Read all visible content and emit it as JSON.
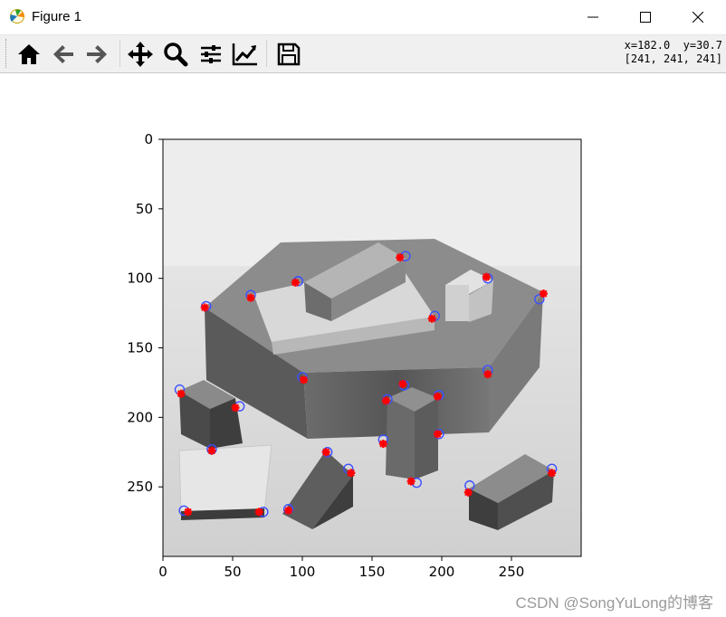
{
  "window": {
    "title": "Figure 1"
  },
  "toolbar": {
    "buttons": [
      "home-icon",
      "back-arrow-icon",
      "forward-arrow-icon",
      "pan-move-icon",
      "zoom-magnifier-icon",
      "configure-subplots-icon",
      "edit-axis-icon",
      "save-disk-icon"
    ],
    "coord_line1": "x=182.0  y=30.7",
    "coord_line2": "[241, 241, 241]"
  },
  "chart_data": {
    "type": "scatter",
    "xlim": [
      0,
      300
    ],
    "ylim": [
      300,
      0
    ],
    "xticks": [
      0,
      50,
      100,
      150,
      200,
      250
    ],
    "yticks": [
      0,
      50,
      100,
      150,
      200,
      250
    ],
    "xtick_labels": [
      "0",
      "50",
      "100",
      "150",
      "200",
      "250"
    ],
    "ytick_labels": [
      "0",
      "50",
      "100",
      "150",
      "200",
      "250"
    ],
    "title": "",
    "xlabel": "",
    "ylabel": "",
    "grid": false,
    "y_inverted": true,
    "series": [
      {
        "marker": "o",
        "color": "#3c50ff",
        "points": [
          [
            31,
            120
          ],
          [
            63,
            112
          ],
          [
            97,
            102
          ],
          [
            174,
            84
          ],
          [
            195,
            127
          ],
          [
            233,
            100
          ],
          [
            270,
            115
          ],
          [
            100,
            171
          ],
          [
            173,
            177
          ],
          [
            161,
            187
          ],
          [
            198,
            184
          ],
          [
            233,
            166
          ],
          [
            12,
            180
          ],
          [
            55,
            192
          ],
          [
            35,
            223
          ],
          [
            118,
            225
          ],
          [
            158,
            216
          ],
          [
            198,
            212
          ],
          [
            133,
            237
          ],
          [
            182,
            247
          ],
          [
            220,
            249
          ],
          [
            279,
            237
          ],
          [
            15,
            267
          ],
          [
            72,
            268
          ],
          [
            90,
            266
          ]
        ]
      },
      {
        "marker": "x",
        "color": "#ff0000",
        "points": [
          [
            30,
            121
          ],
          [
            63,
            114
          ],
          [
            95,
            103
          ],
          [
            170,
            85
          ],
          [
            193,
            129
          ],
          [
            232,
            99
          ],
          [
            273,
            111
          ],
          [
            101,
            173
          ],
          [
            172,
            176
          ],
          [
            160,
            188
          ],
          [
            197,
            185
          ],
          [
            233,
            169
          ],
          [
            13,
            183
          ],
          [
            52,
            193
          ],
          [
            35,
            224
          ],
          [
            117,
            225
          ],
          [
            158,
            219
          ],
          [
            197,
            212
          ],
          [
            135,
            240
          ],
          [
            178,
            246
          ],
          [
            219,
            254
          ],
          [
            279,
            240
          ],
          [
            18,
            268
          ],
          [
            69,
            268
          ],
          [
            90,
            267
          ]
        ]
      }
    ]
  },
  "colors": {
    "plot_frame": "#000000",
    "marker_circle": "#3c50ff",
    "marker_star": "#ff0000"
  },
  "watermark": {
    "text": "CSDN @SongYuLong的博客"
  }
}
